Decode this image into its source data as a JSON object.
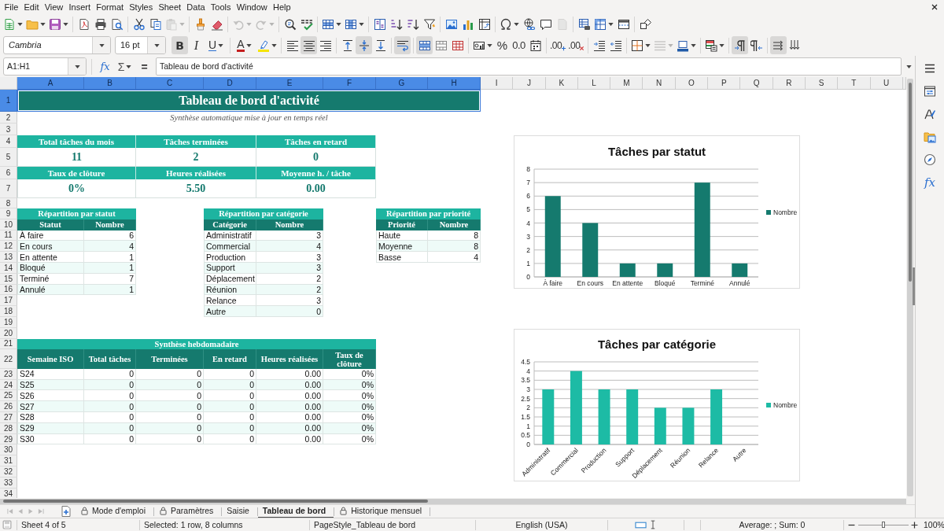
{
  "menu": [
    "File",
    "Edit",
    "View",
    "Insert",
    "Format",
    "Styles",
    "Sheet",
    "Data",
    "Tools",
    "Window",
    "Help"
  ],
  "standard_toolbar": {
    "groups": [
      [
        {
          "kind": "new",
          "dropdown": true,
          "disabled": false
        },
        {
          "kind": "open",
          "dropdown": true,
          "disabled": false
        },
        {
          "kind": "save",
          "dropdown": true,
          "disabled": false
        }
      ],
      [
        {
          "kind": "pdf",
          "dropdown": false,
          "disabled": false
        },
        {
          "kind": "print",
          "dropdown": false,
          "disabled": false
        },
        {
          "kind": "preview",
          "dropdown": false,
          "disabled": false
        }
      ],
      [
        {
          "kind": "cut",
          "dropdown": false,
          "disabled": false
        },
        {
          "kind": "copy",
          "dropdown": false,
          "disabled": false
        },
        {
          "kind": "paste",
          "dropdown": true,
          "disabled": true
        }
      ],
      [
        {
          "kind": "clone",
          "dropdown": false,
          "disabled": false
        },
        {
          "kind": "clear",
          "dropdown": false,
          "disabled": false
        }
      ],
      [
        {
          "kind": "undo",
          "dropdown": true,
          "disabled": true
        },
        {
          "kind": "redo",
          "dropdown": true,
          "disabled": true
        }
      ],
      [
        {
          "kind": "find",
          "dropdown": false,
          "disabled": false
        },
        {
          "kind": "spell",
          "dropdown": false,
          "disabled": false
        }
      ],
      [
        {
          "kind": "rows",
          "dropdown": true,
          "disabled": false
        },
        {
          "kind": "columns",
          "dropdown": true,
          "disabled": false
        }
      ],
      [
        {
          "kind": "sort",
          "dropdown": false,
          "disabled": false
        },
        {
          "kind": "sortasc",
          "dropdown": false,
          "disabled": false
        },
        {
          "kind": "sortdesc",
          "dropdown": false,
          "disabled": false
        },
        {
          "kind": "filter",
          "dropdown": false,
          "disabled": false
        }
      ],
      [
        {
          "kind": "image",
          "dropdown": false,
          "disabled": false
        },
        {
          "kind": "chart",
          "dropdown": false,
          "disabled": false
        },
        {
          "kind": "pivot",
          "dropdown": false,
          "disabled": false
        }
      ],
      [
        {
          "kind": "special",
          "dropdown": true,
          "disabled": false
        },
        {
          "kind": "link",
          "dropdown": false,
          "disabled": false
        },
        {
          "kind": "comment",
          "dropdown": false,
          "disabled": false
        },
        {
          "kind": "headerfooter",
          "dropdown": false,
          "disabled": true
        }
      ],
      [
        {
          "kind": "printarea",
          "dropdown": false,
          "disabled": false
        },
        {
          "kind": "freeze",
          "dropdown": true,
          "disabled": false
        },
        {
          "kind": "split",
          "dropdown": false,
          "disabled": false
        }
      ],
      [
        {
          "kind": "shapes",
          "dropdown": false,
          "disabled": false
        }
      ]
    ]
  },
  "formatting_toolbar": {
    "font_name": "Cambria",
    "font_size": "16 pt",
    "groups": [
      [
        {
          "kind": "bold",
          "glyph": "B",
          "on": true,
          "dropdown": false,
          "disabled": false
        },
        {
          "kind": "italic",
          "glyph": "I",
          "on": false,
          "dropdown": false,
          "disabled": false
        },
        {
          "kind": "underline",
          "glyph": "U",
          "on": false,
          "dropdown": true,
          "disabled": false
        }
      ],
      [
        {
          "kind": "fontcolor",
          "glyph": "A",
          "on": false,
          "dropdown": true,
          "disabled": false
        },
        {
          "kind": "highlight",
          "on": false,
          "dropdown": true,
          "disabled": false
        }
      ],
      [
        {
          "kind": "left",
          "on": false,
          "dropdown": false,
          "disabled": false
        },
        {
          "kind": "center",
          "on": true,
          "dropdown": false,
          "disabled": false
        },
        {
          "kind": "right",
          "on": false,
          "dropdown": false,
          "disabled": false
        }
      ],
      [
        {
          "kind": "top",
          "on": false,
          "dropdown": false,
          "disabled": false
        },
        {
          "kind": "middle",
          "on": true,
          "dropdown": false,
          "disabled": false
        },
        {
          "kind": "bottom",
          "on": false,
          "dropdown": false,
          "disabled": false
        }
      ],
      [
        {
          "kind": "wrap",
          "on": true,
          "dropdown": false,
          "disabled": false
        }
      ],
      [
        {
          "kind": "mergecenter",
          "on": true,
          "dropdown": false,
          "disabled": false
        },
        {
          "kind": "merge",
          "on": false,
          "dropdown": false,
          "disabled": false
        },
        {
          "kind": "unmerge",
          "on": false,
          "dropdown": false,
          "disabled": false
        }
      ],
      [
        {
          "kind": "currency",
          "on": false,
          "dropdown": true,
          "disabled": false
        },
        {
          "kind": "percent",
          "glyph": "%",
          "on": false,
          "dropdown": false,
          "disabled": false
        },
        {
          "kind": "number",
          "glyph": "0.0",
          "on": false,
          "dropdown": false,
          "disabled": false
        },
        {
          "kind": "date",
          "on": false,
          "dropdown": false,
          "disabled": false
        }
      ],
      [
        {
          "kind": "adddecimal",
          "glyph": ".00",
          "on": false,
          "dropdown": false,
          "disabled": false
        },
        {
          "kind": "deletedecimal",
          "glyph": ".00",
          "on": false,
          "dropdown": false,
          "disabled": false
        }
      ],
      [
        {
          "kind": "indent",
          "on": false,
          "dropdown": false,
          "disabled": false
        },
        {
          "kind": "outdent",
          "on": false,
          "dropdown": false,
          "disabled": false
        }
      ],
      [
        {
          "kind": "borders",
          "on": false,
          "dropdown": true,
          "disabled": false
        },
        {
          "kind": "borderstyle",
          "on": false,
          "dropdown": true,
          "disabled": true
        },
        {
          "kind": "bordercolor",
          "on": false,
          "dropdown": true,
          "disabled": false
        }
      ],
      [
        {
          "kind": "conditional",
          "on": false,
          "dropdown": true,
          "disabled": false
        }
      ],
      [
        {
          "kind": "ltr",
          "on": true,
          "dropdown": false,
          "disabled": false
        },
        {
          "kind": "rtl",
          "on": false,
          "dropdown": false,
          "disabled": false
        }
      ],
      [
        {
          "kind": "textdirection",
          "on": true,
          "dropdown": false,
          "disabled": false
        },
        {
          "kind": "vertical",
          "on": false,
          "dropdown": false,
          "disabled": false
        }
      ]
    ]
  },
  "formula_bar": {
    "name_box": "A1:H1",
    "buttons": [
      {
        "kind": "wizard",
        "glyph": "fx",
        "dropdown": false
      },
      {
        "kind": "sum",
        "glyph": "Σ",
        "dropdown": true
      },
      {
        "kind": "formula",
        "glyph": "=",
        "dropdown": false
      }
    ],
    "content": "Tableau de bord d'activité"
  },
  "sidebar": {
    "tabs": [
      {
        "kind": "menu"
      },
      {
        "kind": "properties"
      },
      {
        "kind": "styles"
      },
      {
        "kind": "gallery"
      },
      {
        "kind": "navigator"
      },
      {
        "kind": "functions",
        "glyph": "fx"
      }
    ]
  },
  "sheet": {
    "columns": [
      {
        "label": "A",
        "selected": true
      },
      {
        "label": "B",
        "selected": true
      },
      {
        "label": "C",
        "selected": true
      },
      {
        "label": "D",
        "selected": true
      },
      {
        "label": "E",
        "selected": true
      },
      {
        "label": "F",
        "selected": true
      },
      {
        "label": "G",
        "selected": true
      },
      {
        "label": "H",
        "selected": true
      },
      {
        "label": "I",
        "selected": false
      },
      {
        "label": "J",
        "selected": false
      },
      {
        "label": "K",
        "selected": false
      },
      {
        "label": "L",
        "selected": false
      },
      {
        "label": "M",
        "selected": false
      },
      {
        "label": "N",
        "selected": false
      },
      {
        "label": "O",
        "selected": false
      },
      {
        "label": "P",
        "selected": false
      },
      {
        "label": "Q",
        "selected": false
      },
      {
        "label": "R",
        "selected": false
      },
      {
        "label": "S",
        "selected": false
      },
      {
        "label": "T",
        "selected": false
      },
      {
        "label": "U",
        "selected": false
      }
    ],
    "rows": [
      {
        "label": "1",
        "selected": true
      },
      {
        "label": "2",
        "selected": false
      },
      {
        "label": "3",
        "selected": false
      },
      {
        "label": "4",
        "selected": false
      },
      {
        "label": "5",
        "selected": false
      },
      {
        "label": "6",
        "selected": false
      },
      {
        "label": "7",
        "selected": false
      },
      {
        "label": "8",
        "selected": false
      },
      {
        "label": "9",
        "selected": false
      },
      {
        "label": "10",
        "selected": false
      },
      {
        "label": "11",
        "selected": false
      },
      {
        "label": "12",
        "selected": false
      },
      {
        "label": "13",
        "selected": false
      },
      {
        "label": "14",
        "selected": false
      },
      {
        "label": "15",
        "selected": false
      },
      {
        "label": "16",
        "selected": false
      },
      {
        "label": "17",
        "selected": false
      },
      {
        "label": "18",
        "selected": false
      },
      {
        "label": "19",
        "selected": false
      },
      {
        "label": "20",
        "selected": false
      },
      {
        "label": "21",
        "selected": false
      },
      {
        "label": "22",
        "selected": false
      },
      {
        "label": "23",
        "selected": false
      },
      {
        "label": "24",
        "selected": false
      },
      {
        "label": "25",
        "selected": false
      },
      {
        "label": "26",
        "selected": false
      },
      {
        "label": "27",
        "selected": false
      },
      {
        "label": "28",
        "selected": false
      },
      {
        "label": "29",
        "selected": false
      },
      {
        "label": "30",
        "selected": false
      },
      {
        "label": "31",
        "selected": false
      },
      {
        "label": "32",
        "selected": false
      },
      {
        "label": "33",
        "selected": false
      },
      {
        "label": "34",
        "selected": false
      }
    ],
    "title": {
      "text": "Tableau de bord d'activité",
      "selected": true
    },
    "subtitle": "Synthèse automatique mise à jour en temps réel",
    "kpis": [
      {
        "label": "Total tâches du mois",
        "value": "11"
      },
      {
        "label": "Tâches terminées",
        "value": "2"
      },
      {
        "label": "Tâches en retard",
        "value": "0"
      },
      {
        "label": "Taux de clôture",
        "value": "0%"
      },
      {
        "label": "Heures réalisées",
        "value": "5.50"
      },
      {
        "label": "Moyenne h. / tâche",
        "value": "0.00"
      }
    ],
    "tables": [
      {
        "title": "Répartition par statut",
        "columns": [
          "Statut",
          "Nombre"
        ],
        "rows": [
          [
            "À faire",
            "6"
          ],
          [
            "En cours",
            "4"
          ],
          [
            "En attente",
            "1"
          ],
          [
            "Bloqué",
            "1"
          ],
          [
            "Terminé",
            "7"
          ],
          [
            "Annulé",
            "1"
          ]
        ]
      },
      {
        "title": "Répartition par catégorie",
        "columns": [
          "Catégorie",
          "Nombre"
        ],
        "rows": [
          [
            "Administratif",
            "3"
          ],
          [
            "Commercial",
            "4"
          ],
          [
            "Production",
            "3"
          ],
          [
            "Support",
            "3"
          ],
          [
            "Déplacement",
            "2"
          ],
          [
            "Réunion",
            "2"
          ],
          [
            "Relance",
            "3"
          ],
          [
            "Autre",
            "0"
          ]
        ]
      },
      {
        "title": "Répartition par priorité",
        "columns": [
          "Priorité",
          "Nombre"
        ],
        "rows": [
          [
            "Haute",
            "8"
          ],
          [
            "Moyenne",
            "8"
          ],
          [
            "Basse",
            "4"
          ]
        ]
      }
    ],
    "weekly": {
      "title": "Synthèse hebdomadaire",
      "columns": [
        "Semaine ISO",
        "Total tâches",
        "Terminées",
        "En retard",
        "Heures réalisées",
        "Taux de clôture"
      ],
      "rows": [
        [
          "S24",
          "0",
          "0",
          "0",
          "0.00",
          "0%"
        ],
        [
          "S25",
          "0",
          "0",
          "0",
          "0.00",
          "0%"
        ],
        [
          "S26",
          "0",
          "0",
          "0",
          "0.00",
          "0%"
        ],
        [
          "S27",
          "0",
          "0",
          "0",
          "0.00",
          "0%"
        ],
        [
          "S28",
          "0",
          "0",
          "0",
          "0.00",
          "0%"
        ],
        [
          "S29",
          "0",
          "0",
          "0",
          "0.00",
          "0%"
        ],
        [
          "S30",
          "0",
          "0",
          "0",
          "0.00",
          "0%"
        ]
      ]
    },
    "charts": [
      {
        "chart_data": {
          "type": "bar",
          "title": "Tâches par statut",
          "categories": [
            "À faire",
            "En cours",
            "En attente",
            "Bloqué",
            "Terminé",
            "Annulé"
          ],
          "series": [
            {
              "name": "Nombre",
              "color": "#157a6e",
              "values": [
                6,
                4,
                1,
                1,
                7,
                1
              ]
            }
          ],
          "ylim": [
            0,
            8
          ],
          "yticks": [
            0,
            1,
            2,
            3,
            4,
            5,
            6,
            7,
            8
          ],
          "grid": true
        }
      },
      {
        "chart_data": {
          "type": "bar",
          "title": "Tâches par catégorie",
          "categories": [
            "Administratif",
            "Commercial",
            "Production",
            "Support",
            "Déplacement",
            "Réunion",
            "Relance",
            "Autre"
          ],
          "series": [
            {
              "name": "Nombre",
              "color": "#1dbba5",
              "values": [
                3,
                4,
                3,
                3,
                2,
                2,
                3,
                0
              ]
            }
          ],
          "ylim": [
            0,
            4.5
          ],
          "yticks": [
            0,
            0.5,
            1,
            1.5,
            2,
            2.5,
            3,
            3.5,
            4,
            4.5
          ],
          "grid": true
        }
      }
    ]
  },
  "sheet_tabs": {
    "nav": [
      {
        "kind": "first",
        "disabled": true
      },
      {
        "kind": "previous",
        "disabled": true
      },
      {
        "kind": "next",
        "disabled": true
      },
      {
        "kind": "last",
        "disabled": true
      }
    ],
    "tabs": [
      {
        "label": "Mode d'emploi",
        "locked": true,
        "selected": false
      },
      {
        "label": "Paramètres",
        "locked": true,
        "selected": false
      },
      {
        "label": "Saisie",
        "locked": false,
        "selected": false
      },
      {
        "label": "Tableau de bord",
        "locked": false,
        "selected": true
      },
      {
        "label": "Historique mensuel",
        "locked": true,
        "selected": false
      }
    ]
  },
  "status_bar": {
    "sheet": "Sheet 4 of 5",
    "selection": "Selected: 1 row, 8 columns",
    "page_style": "PageStyle_Tableau de bord",
    "language": "English (USA)",
    "summary": "Average: ; Sum: 0",
    "zoom": {
      "level": 0.5,
      "reading": "100%"
    }
  }
}
